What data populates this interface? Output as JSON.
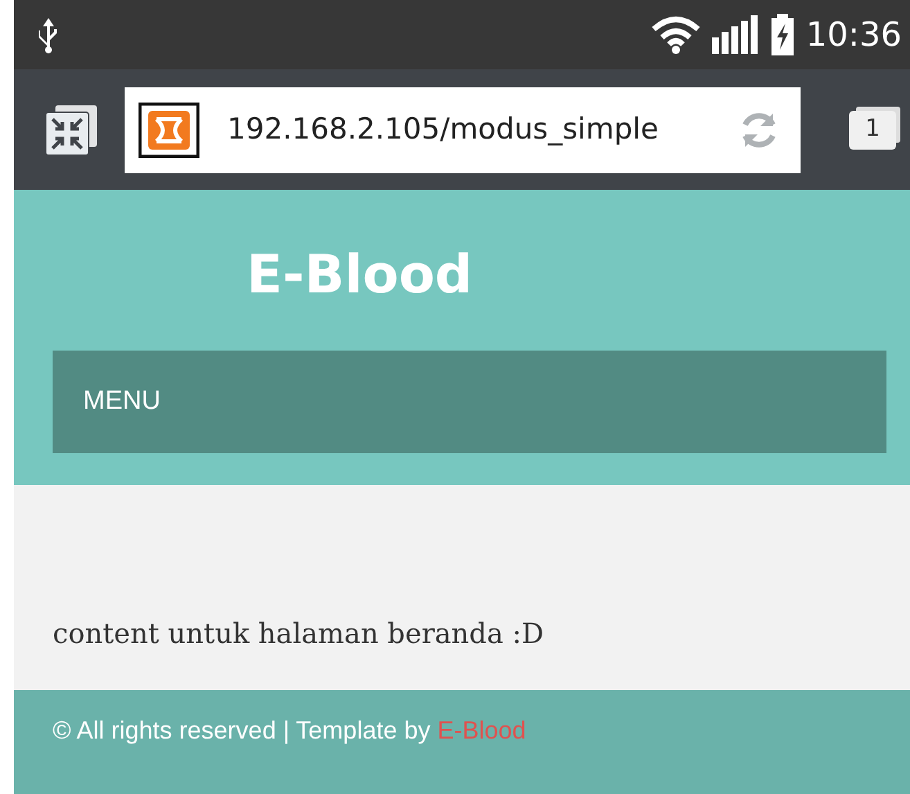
{
  "status_bar": {
    "time": "10:36"
  },
  "browser": {
    "url": "192.168.2.105/modus_simple",
    "tab_count": "1"
  },
  "site": {
    "title": "E-Blood",
    "menu": "MENU",
    "content": "content untuk halaman beranda :D",
    "footer": {
      "text": "© All rights reserved | Template by ",
      "link": "E-Blood"
    }
  }
}
